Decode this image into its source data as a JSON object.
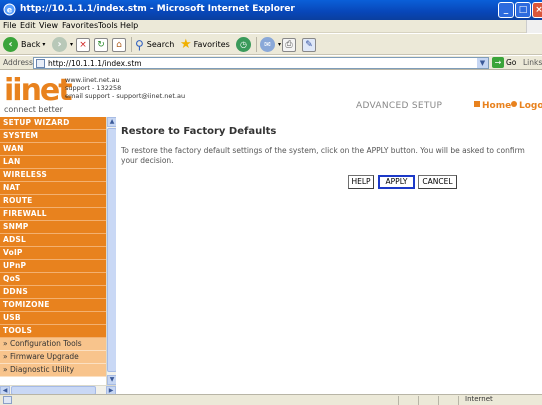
{
  "window": {
    "title": "http://10.1.1.1/index.stm - Microsoft Internet Explorer",
    "controls": [
      "minimize",
      "maximize",
      "close"
    ]
  },
  "menu": [
    "File",
    "Edit",
    "View",
    "Favorites",
    "Tools",
    "Help"
  ],
  "toolbar": {
    "back_label": "Back",
    "search_label": "Search",
    "favorites_label": "Favorites"
  },
  "address": {
    "label": "Address",
    "url": "http://10.1.1.1/index.stm",
    "go_label": "Go",
    "links_label": "Links"
  },
  "brand": {
    "logo": "iinet",
    "tagline": "connect better",
    "contact": [
      "www.iinet.net.au",
      "support - 132258",
      "email support - support@iinet.net.au"
    ],
    "accent_color": "#e8821e"
  },
  "header": {
    "section": "ADVANCED SETUP",
    "home_label": "Home",
    "logout_label": "Logout"
  },
  "sidebar": {
    "items": [
      "SETUP WIZARD",
      "SYSTEM",
      "WAN",
      "LAN",
      "WIRELESS",
      "NAT",
      "ROUTE",
      "FIREWALL",
      "SNMP",
      "ADSL",
      "VoIP",
      "UPnP",
      "QoS",
      "DDNS",
      "TOMIZONE",
      "USB",
      "TOOLS"
    ],
    "subitems": [
      "» Configuration Tools",
      "» Firmware Upgrade",
      "» Diagnostic Utility"
    ]
  },
  "main": {
    "title": "Restore to Factory Defaults",
    "description": "To restore the factory default settings of the system, click on the APPLY button. You will be asked to confirm your decision.",
    "buttons": {
      "help": "HELP",
      "apply": "APPLY",
      "cancel": "CANCEL"
    }
  },
  "status": {
    "zone": "Internet"
  }
}
